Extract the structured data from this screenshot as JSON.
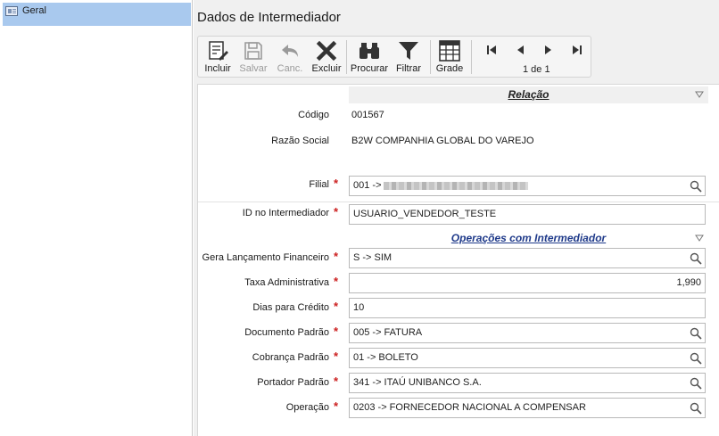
{
  "sidebar": {
    "items": [
      {
        "label": "Geral",
        "icon": "form-icon"
      }
    ]
  },
  "page": {
    "title": "Dados de Intermediador"
  },
  "toolbar": {
    "include": "Incluir",
    "save": "Salvar",
    "cancel": "Canc.",
    "delete": "Excluir",
    "search": "Procurar",
    "filter": "Filtrar",
    "grid": "Grade",
    "pager": "1 de 1"
  },
  "sections": {
    "relacao": "Relação",
    "operacoes": "Operações com Intermediador"
  },
  "fields": {
    "codigo": {
      "label": "Código",
      "value": "001567"
    },
    "razao_social": {
      "label": "Razão Social",
      "value": "B2W COMPANHIA GLOBAL DO VAREJO"
    },
    "filial": {
      "label": "Filial",
      "value": "001  ->"
    },
    "id_intermediador": {
      "label": "ID no Intermediador",
      "value": "USUARIO_VENDEDOR_TESTE"
    },
    "gera_lancamento": {
      "label": "Gera Lançamento Financeiro",
      "value": "S   -> SIM"
    },
    "taxa_administrativa": {
      "label": "Taxa Administrativa",
      "value": "1,990"
    },
    "dias_credito": {
      "label": "Dias para Crédito",
      "value": "10"
    },
    "documento_padrao": {
      "label": "Documento Padrão",
      "value": "005   -> FATURA"
    },
    "cobranca_padrao": {
      "label": "Cobrança Padrão",
      "value": "01   -> BOLETO"
    },
    "portador_padrao": {
      "label": "Portador Padrão",
      "value": "341   -> ITAÚ UNIBANCO S.A."
    },
    "operacao": {
      "label": "Operação",
      "value": "0203   -> FORNECEDOR NACIONAL A COMPENSAR"
    }
  },
  "colors": {
    "sidebar_selected": "#a9c9ee",
    "required": "#cc1f1f",
    "section_link": "#1f3a8a"
  }
}
